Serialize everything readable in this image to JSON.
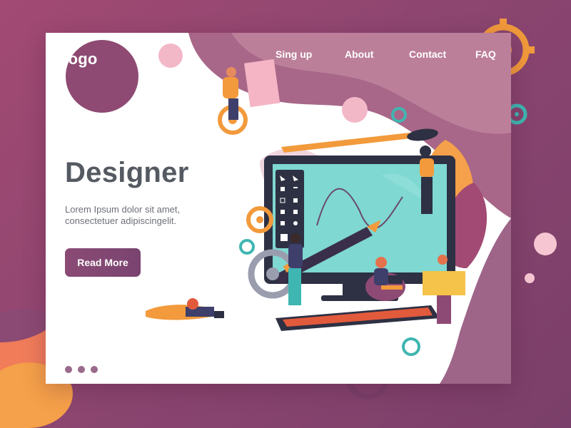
{
  "brand": {
    "logo": "Logo"
  },
  "nav": {
    "items": [
      "Sing up",
      "About",
      "Contact",
      "FAQ"
    ]
  },
  "hero": {
    "title": "Designer",
    "text_line1": "Lorem Ipsum dolor sit amet,",
    "text_line2": "consectetuer adipiscingelit.",
    "cta": "Read More"
  },
  "pagination": {
    "count": 3
  },
  "colors": {
    "background": "#8d4670",
    "card": "#ffffff",
    "accent_purple": "#8a4b75",
    "heading": "#555a62",
    "body_text": "#6d7078",
    "teal": "#3fb6b1",
    "orange": "#f29a3c",
    "screen": "#7fd8d2"
  },
  "illustration": {
    "subject": "graphic designer workspace",
    "elements": [
      "monitor-with-drawing-canvas",
      "tool-palette",
      "giant-pen",
      "paintbrush",
      "keyboard",
      "gears",
      "monstera-leaves",
      "designers"
    ]
  }
}
